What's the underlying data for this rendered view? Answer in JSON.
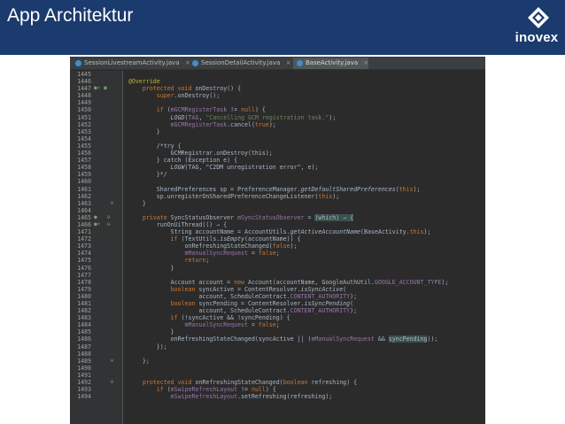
{
  "slide": {
    "title": "App Architektur",
    "brand": {
      "name": "inovex",
      "icon": "inovex-logo-icon"
    }
  },
  "editor": {
    "tabs": [
      {
        "label": "SessionLivestreamActivity.java",
        "close": "×",
        "active": false,
        "icon": "java-class-icon"
      },
      {
        "label": "SessionDetailActivity.java",
        "close": "×",
        "active": false,
        "icon": "java-class-icon"
      },
      {
        "label": "BaseActivity.java",
        "close": "×",
        "active": true,
        "icon": "java-class-icon"
      }
    ],
    "colors": {
      "background": "#2b2b2b",
      "keyword": "#cc7832",
      "string": "#6a8759",
      "field": "#9876aa",
      "annotation": "#bbb529",
      "comment": "#808080"
    },
    "lines": [
      {
        "n": "1445",
        "m": "",
        "c": []
      },
      {
        "n": "1446",
        "m": "",
        "c": [
          [
            "an",
            "@Override"
          ]
        ]
      },
      {
        "n": "1447",
        "m": "●↑ ●",
        "c": [
          [
            "",
            "    "
          ],
          [
            "kw",
            "protected void "
          ],
          [
            "",
            "onDestroy() {"
          ]
        ]
      },
      {
        "n": "1448",
        "m": "",
        "c": [
          [
            "",
            "        "
          ],
          [
            "kw",
            "super"
          ],
          [
            "",
            ".onDestroy();"
          ]
        ]
      },
      {
        "n": "1449",
        "m": "",
        "c": []
      },
      {
        "n": "1450",
        "m": "",
        "c": [
          [
            "",
            "        "
          ],
          [
            "kw",
            "if "
          ],
          [
            "",
            "("
          ],
          [
            "fd",
            "mGCMRegisterTask"
          ],
          [
            "",
            " != "
          ],
          [
            "kw",
            "null"
          ],
          [
            "",
            ") {"
          ]
        ]
      },
      {
        "n": "1451",
        "m": "",
        "c": [
          [
            "",
            "            "
          ],
          [
            "it",
            "LOGD"
          ],
          [
            "",
            "("
          ],
          [
            "fd",
            "TAG"
          ],
          [
            "",
            ", "
          ],
          [
            "st",
            "\"Cancelling GCM registration task.\""
          ],
          [
            "",
            ");"
          ]
        ]
      },
      {
        "n": "1452",
        "m": "",
        "c": [
          [
            "",
            "            "
          ],
          [
            "fd",
            "mGCMRegisterTask"
          ],
          [
            "",
            ".cancel("
          ],
          [
            "kw",
            "true"
          ],
          [
            "",
            ");"
          ]
        ]
      },
      {
        "n": "1453",
        "m": "",
        "c": [
          [
            "",
            "        }"
          ]
        ]
      },
      {
        "n": "1454",
        "m": "",
        "c": []
      },
      {
        "n": "1455",
        "m": "",
        "c": [
          [
            "",
            "        /*try {"
          ]
        ]
      },
      {
        "n": "1456",
        "m": "",
        "c": [
          [
            "",
            "            GCMRegistrar.onDestroy(this);"
          ]
        ]
      },
      {
        "n": "1457",
        "m": "",
        "c": [
          [
            "",
            "        } catch (Exception e) {"
          ]
        ]
      },
      {
        "n": "1458",
        "m": "",
        "c": [
          [
            "",
            "            "
          ],
          [
            "it",
            "LOGW"
          ],
          [
            "",
            "(TAG, \"C2DM unregistration error\", e);"
          ]
        ]
      },
      {
        "n": "1459",
        "m": "",
        "c": [
          [
            "",
            "        }*/"
          ]
        ]
      },
      {
        "n": "1460",
        "m": "",
        "c": []
      },
      {
        "n": "1461",
        "m": "",
        "c": [
          [
            "",
            "        SharedPreferences sp = PreferenceManager."
          ],
          [
            "it",
            "getDefaultSharedPreferences"
          ],
          [
            "",
            "("
          ],
          [
            "kw",
            "this"
          ],
          [
            "",
            ");"
          ]
        ]
      },
      {
        "n": "1462",
        "m": "",
        "c": [
          [
            "",
            "        sp.unregisterOnSharedPreferenceChangeListener("
          ],
          [
            "kw",
            "this"
          ],
          [
            "",
            ");"
          ]
        ]
      },
      {
        "n": "1463",
        "m": "     ⊖",
        "c": [
          [
            "",
            "    }"
          ]
        ]
      },
      {
        "n": "1464",
        "m": "",
        "c": []
      },
      {
        "n": "1465",
        "m": "●   ⊖",
        "c": [
          [
            "",
            "    "
          ],
          [
            "kw",
            "private "
          ],
          [
            "",
            "SyncStatusObserver "
          ],
          [
            "fd",
            "mSyncStatusObserver"
          ],
          [
            "",
            " = "
          ],
          [
            "hl",
            "(which) → {"
          ]
        ]
      },
      {
        "n": "1466",
        "m": "●↑  ⊖",
        "c": [
          [
            "",
            "        runOnUiThread(() → {"
          ]
        ]
      },
      {
        "n": "1471",
        "m": "",
        "c": [
          [
            "",
            "            String accountName = AccountUtils."
          ],
          [
            "it",
            "getActiveAccountName"
          ],
          [
            "",
            "(BaseActivity."
          ],
          [
            "kw",
            "this"
          ],
          [
            "",
            ");"
          ]
        ]
      },
      {
        "n": "1472",
        "m": "",
        "c": [
          [
            "",
            "            "
          ],
          [
            "kw",
            "if "
          ],
          [
            "",
            "(TextUtils."
          ],
          [
            "it",
            "isEmpty"
          ],
          [
            "",
            "(accountName)) {"
          ]
        ]
      },
      {
        "n": "1473",
        "m": "",
        "c": [
          [
            "",
            "                onRefreshingStateChanged("
          ],
          [
            "kw",
            "false"
          ],
          [
            "",
            ");"
          ]
        ]
      },
      {
        "n": "1474",
        "m": "",
        "c": [
          [
            "",
            "                "
          ],
          [
            "fd",
            "mManualSyncRequest"
          ],
          [
            "",
            " = "
          ],
          [
            "kw",
            "false"
          ],
          [
            "",
            ";"
          ]
        ]
      },
      {
        "n": "1475",
        "m": "",
        "c": [
          [
            "",
            "                "
          ],
          [
            "kw",
            "return"
          ],
          [
            "",
            ";"
          ]
        ]
      },
      {
        "n": "1476",
        "m": "",
        "c": [
          [
            "",
            "            }"
          ]
        ]
      },
      {
        "n": "1477",
        "m": "",
        "c": []
      },
      {
        "n": "1478",
        "m": "",
        "c": [
          [
            "",
            "            Account account = "
          ],
          [
            "kw",
            "new "
          ],
          [
            "",
            "Account(accountName, GoogleAuthUtil."
          ],
          [
            "fd",
            "GOOGLE_ACCOUNT_TYPE"
          ],
          [
            "",
            ");"
          ]
        ]
      },
      {
        "n": "1479",
        "m": "",
        "c": [
          [
            "",
            "            "
          ],
          [
            "kw",
            "boolean "
          ],
          [
            "",
            "syncActive = ContentResolver."
          ],
          [
            "it",
            "isSyncActive"
          ],
          [
            "",
            "("
          ]
        ]
      },
      {
        "n": "1480",
        "m": "",
        "c": [
          [
            "",
            "                    account, ScheduleContract."
          ],
          [
            "fd",
            "CONTENT_AUTHORITY"
          ],
          [
            "",
            ");"
          ]
        ]
      },
      {
        "n": "1481",
        "m": "",
        "c": [
          [
            "",
            "            "
          ],
          [
            "kw",
            "boolean "
          ],
          [
            "",
            "syncPending = ContentResolver."
          ],
          [
            "it",
            "isSyncPending"
          ],
          [
            "",
            "("
          ]
        ]
      },
      {
        "n": "1482",
        "m": "",
        "c": [
          [
            "",
            "                    account, ScheduleContract."
          ],
          [
            "fd",
            "CONTENT_AUTHORITY"
          ],
          [
            "",
            ");"
          ]
        ]
      },
      {
        "n": "1483",
        "m": "",
        "c": [
          [
            "",
            "            "
          ],
          [
            "kw",
            "if "
          ],
          [
            "",
            "(!syncActive && !syncPending) {"
          ]
        ]
      },
      {
        "n": "1484",
        "m": "",
        "c": [
          [
            "",
            "                "
          ],
          [
            "fd",
            "mManualSyncRequest"
          ],
          [
            "",
            " = "
          ],
          [
            "kw",
            "false"
          ],
          [
            "",
            ";"
          ]
        ]
      },
      {
        "n": "1485",
        "m": "",
        "c": [
          [
            "",
            "            }"
          ]
        ]
      },
      {
        "n": "1486",
        "m": "",
        "c": [
          [
            "",
            "            onRefreshingStateChanged(syncActive || ("
          ],
          [
            "fd",
            "mManualSyncRequest"
          ],
          [
            "",
            " && "
          ],
          [
            "hl",
            "syncPending"
          ],
          [
            "",
            "));"
          ]
        ]
      },
      {
        "n": "1487",
        "m": "",
        "c": [
          [
            "",
            "        });"
          ]
        ]
      },
      {
        "n": "1488",
        "m": "",
        "c": []
      },
      {
        "n": "1489",
        "m": "     ⊖",
        "c": [
          [
            "",
            "    };"
          ]
        ]
      },
      {
        "n": "1490",
        "m": "",
        "c": []
      },
      {
        "n": "1491",
        "m": "",
        "c": []
      },
      {
        "n": "1492",
        "m": "     ⊖",
        "c": [
          [
            "",
            "    "
          ],
          [
            "kw",
            "protected void "
          ],
          [
            "",
            "onRefreshingStateChanged("
          ],
          [
            "kw",
            "boolean "
          ],
          [
            "",
            "refreshing) {"
          ]
        ]
      },
      {
        "n": "1493",
        "m": "",
        "c": [
          [
            "",
            "        "
          ],
          [
            "kw",
            "if "
          ],
          [
            "",
            "("
          ],
          [
            "fd",
            "mSwipeRefreshLayout"
          ],
          [
            "",
            " != "
          ],
          [
            "kw",
            "null"
          ],
          [
            "",
            ") {"
          ]
        ]
      },
      {
        "n": "1494",
        "m": "",
        "c": [
          [
            "",
            "            "
          ],
          [
            "fd",
            "mSwipeRefreshLayout"
          ],
          [
            "",
            ".setRefreshing(refreshing);"
          ]
        ]
      }
    ]
  }
}
